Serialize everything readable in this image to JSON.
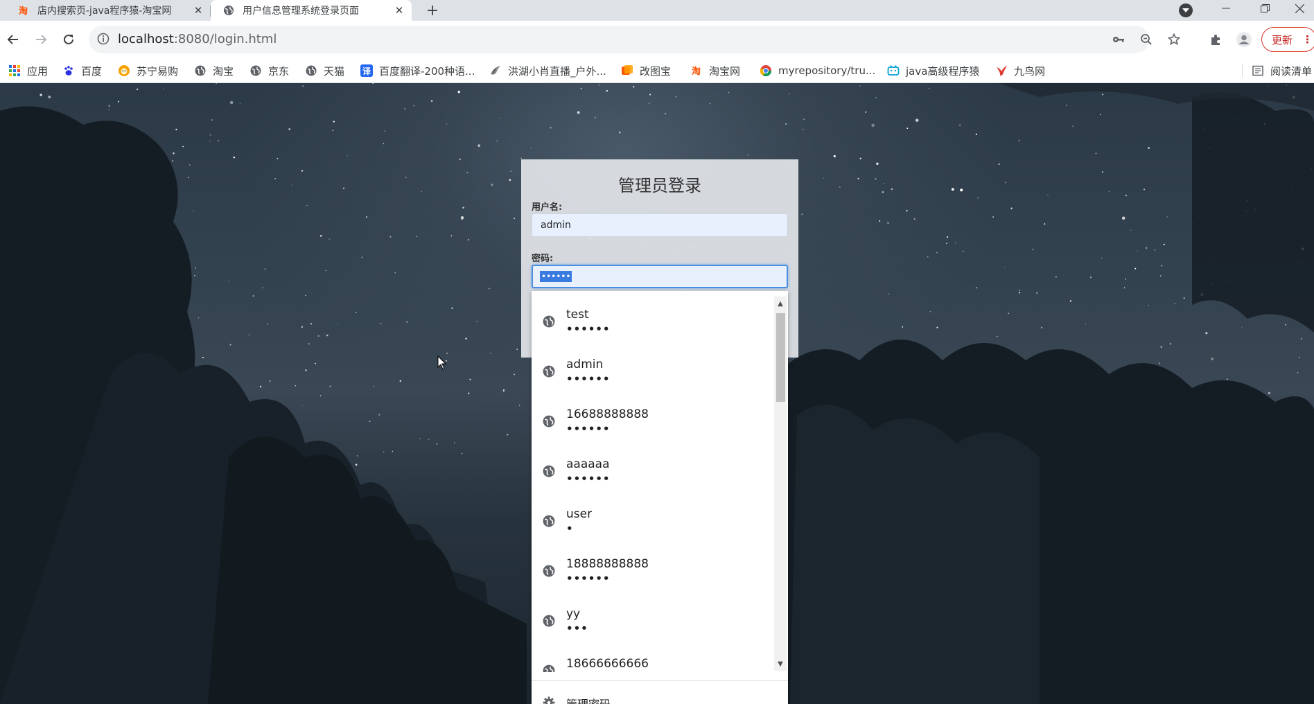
{
  "browser": {
    "tabs": [
      {
        "title": "店内搜索页-java程序猿-淘宝网",
        "active": false
      },
      {
        "title": "用户信息管理系统登录页面",
        "active": true
      }
    ],
    "url_host": "localhost",
    "url_path": ":8080/login.html",
    "update_label": "更新",
    "accent_update": "#d93025"
  },
  "bookmarks": [
    {
      "label": "应用",
      "icon": "apps-grid-icon"
    },
    {
      "label": "百度",
      "icon": "baidu-paw-icon"
    },
    {
      "label": "苏宁易购",
      "icon": "suning-lion-icon"
    },
    {
      "label": "淘宝",
      "icon": "globe-icon"
    },
    {
      "label": "京东",
      "icon": "globe-icon"
    },
    {
      "label": "天猫",
      "icon": "globe-icon"
    },
    {
      "label": "百度翻译-200种语...",
      "icon": "baidu-translate-icon"
    },
    {
      "label": "洪湖小肖直播_户外...",
      "icon": "bird-icon"
    },
    {
      "label": "改图宝",
      "icon": "gaitubao-icon"
    },
    {
      "label": "淘宝网",
      "icon": "taobao-icon"
    },
    {
      "label": "myrepository/tru...",
      "icon": "chrome-icon"
    },
    {
      "label": "java高级程序猿",
      "icon": "bilibili-icon"
    },
    {
      "label": "九鸟网",
      "icon": "bird-red-icon"
    },
    {
      "label": "阅读清单",
      "icon": "reading-list-icon"
    }
  ],
  "login": {
    "title": "管理员登录",
    "username_label": "用户名:",
    "username_value": "admin",
    "password_label": "密码:",
    "password_value": "••••••"
  },
  "autofill": {
    "items": [
      {
        "user": "test",
        "pass": "••••••"
      },
      {
        "user": "admin",
        "pass": "••••••"
      },
      {
        "user": "16688888888",
        "pass": "••••••"
      },
      {
        "user": "aaaaaa",
        "pass": "••••••"
      },
      {
        "user": "user",
        "pass": "•"
      },
      {
        "user": "18888888888",
        "pass": "••••••"
      },
      {
        "user": "yy",
        "pass": "•••"
      },
      {
        "user": "18666666666",
        "pass": ""
      }
    ],
    "manage_label": "管理密码..."
  }
}
